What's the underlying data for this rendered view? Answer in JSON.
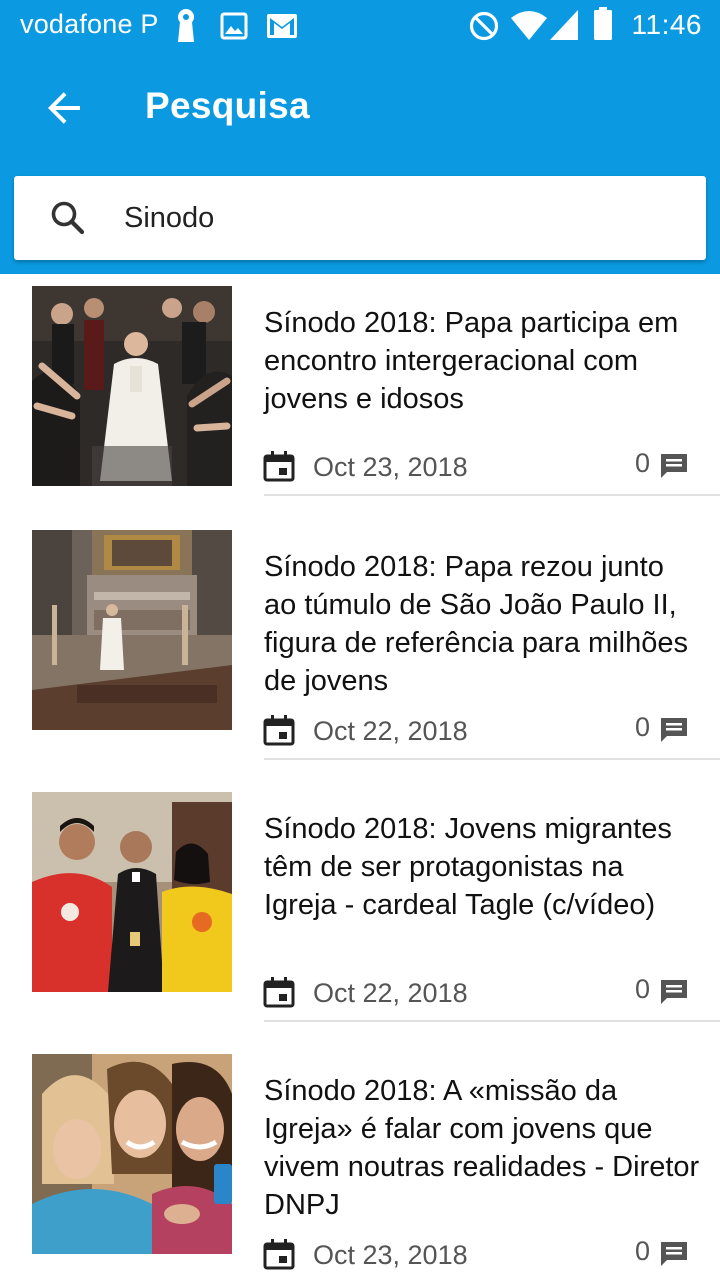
{
  "status_bar": {
    "carrier": "vodafone P",
    "time": "11:46",
    "icons": [
      "keyhole-icon",
      "image-icon",
      "gmail-icon",
      "do-not-disturb-icon",
      "wifi-icon",
      "signal-icon",
      "battery-icon"
    ]
  },
  "toolbar": {
    "title": "Pesquisa",
    "back_icon": "arrow-back-icon"
  },
  "search": {
    "value": "Sinodo",
    "icon": "search-icon"
  },
  "colors": {
    "primary": "#0b9ae2",
    "text": "#111111",
    "secondary_text": "#555555",
    "divider": "#e0e0e0"
  },
  "results": [
    {
      "title": "Sínodo 2018: Papa participa em encontro intergeracional com jovens e idosos",
      "date": "Oct 23, 2018",
      "comments": "0"
    },
    {
      "title": "Sínodo 2018: Papa rezou junto ao túmulo de São João Paulo II, figura de referência para milhões de jovens",
      "date": "Oct 22, 2018",
      "comments": "0"
    },
    {
      "title": "Sínodo 2018: Jovens migrantes têm de ser protagonistas na Igreja - cardeal Tagle (c/vídeo)",
      "date": "Oct 22, 2018",
      "comments": "0"
    },
    {
      "title": "Sínodo 2018: A «missão da Igreja» é falar com jovens que vivem noutras realidades - Diretor DNPJ",
      "date": "Oct 23, 2018",
      "comments": "0"
    }
  ]
}
